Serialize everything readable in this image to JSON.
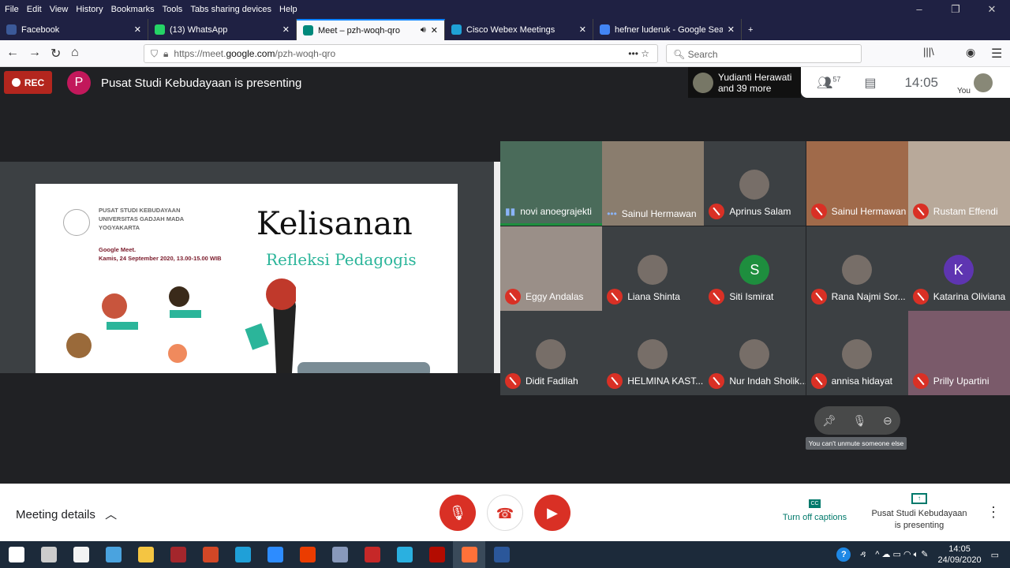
{
  "menu": [
    "File",
    "Edit",
    "View",
    "History",
    "Bookmarks",
    "Tools",
    "Tabs sharing devices",
    "Help"
  ],
  "tabs": [
    {
      "title": "Facebook",
      "icon": "facebook-icon",
      "color": "#3b5998",
      "active": false
    },
    {
      "title": "(13) WhatsApp",
      "icon": "whatsapp-icon",
      "color": "#25d366",
      "active": false
    },
    {
      "title": "Meet – pzh-woqh-qro",
      "icon": "meet-icon",
      "color": "#00897b",
      "active": true
    },
    {
      "title": "Cisco Webex Meetings",
      "icon": "webex-icon",
      "color": "#1fa1d6",
      "active": false
    },
    {
      "title": "hefner luderuk - Google Search",
      "icon": "google-icon",
      "color": "#4285f4",
      "active": false
    }
  ],
  "url": {
    "prefix": "https://meet.",
    "domain": "google.com",
    "path": "/pzh-woqh-qro"
  },
  "search_placeholder": "Search",
  "meet": {
    "rec": "REC",
    "presenter_initial": "P",
    "presenting_title": "Pusat Studi Kebudayaan is presenting",
    "speaker": "Yudianti Herawati",
    "speaker_more": "and 39 more",
    "participant_count": "57",
    "time": "14:05",
    "you": "You"
  },
  "slide": {
    "org": [
      "PUSAT STUDI KEBUDAYAAN",
      "UNIVERSITAS GADJAH MADA",
      "YOGYAKARTA"
    ],
    "meet_line1": "Google Meet.",
    "meet_line2": "Kamis, 24 September 2020, 13.00-15.00 WIB",
    "title": "Kelisanan",
    "subtitle": "Refleksi Pedagogis"
  },
  "participants": [
    {
      "name": "novi anoegrajekti",
      "type": "video",
      "status": "speaking"
    },
    {
      "name": "Sainul Hermawan",
      "type": "video",
      "status": "unmuted"
    },
    {
      "name": "Aprinus Salam",
      "type": "avatar",
      "status": "muted"
    },
    {
      "name": "Sainul Hermawan",
      "type": "video",
      "status": "muted"
    },
    {
      "name": "Rustam Effendi",
      "type": "video",
      "status": "muted"
    },
    {
      "name": "Eggy Andalas",
      "type": "video",
      "status": "muted"
    },
    {
      "name": "Liana Shinta",
      "type": "avatar",
      "status": "muted"
    },
    {
      "name": "Siti Ismirat",
      "type": "letter",
      "letter": "S",
      "color": "#1e8e3e",
      "status": "muted"
    },
    {
      "name": "Rana Najmi Sor...",
      "type": "avatar",
      "status": "muted"
    },
    {
      "name": "Katarina Oliviana",
      "type": "letter",
      "letter": "K",
      "color": "#5e35b1",
      "status": "muted"
    },
    {
      "name": "Didit Fadilah",
      "type": "avatar",
      "status": "muted"
    },
    {
      "name": "HELMINA KAST...",
      "type": "avatar",
      "status": "muted"
    },
    {
      "name": "Nur Indah Sholik...",
      "type": "avatar",
      "status": "muted"
    },
    {
      "name": "annisa hidayat",
      "type": "avatar",
      "status": "muted"
    },
    {
      "name": "Prilly Upartini",
      "type": "video",
      "status": "muted"
    }
  ],
  "tooltip": "You can't unmute someone else",
  "bottom": {
    "details": "Meeting details",
    "captions": "Turn off captions",
    "presenting": "Pusat Studi Kebudayaan is presenting"
  },
  "taskbar": {
    "time": "14:05",
    "date": "24/09/2020"
  }
}
